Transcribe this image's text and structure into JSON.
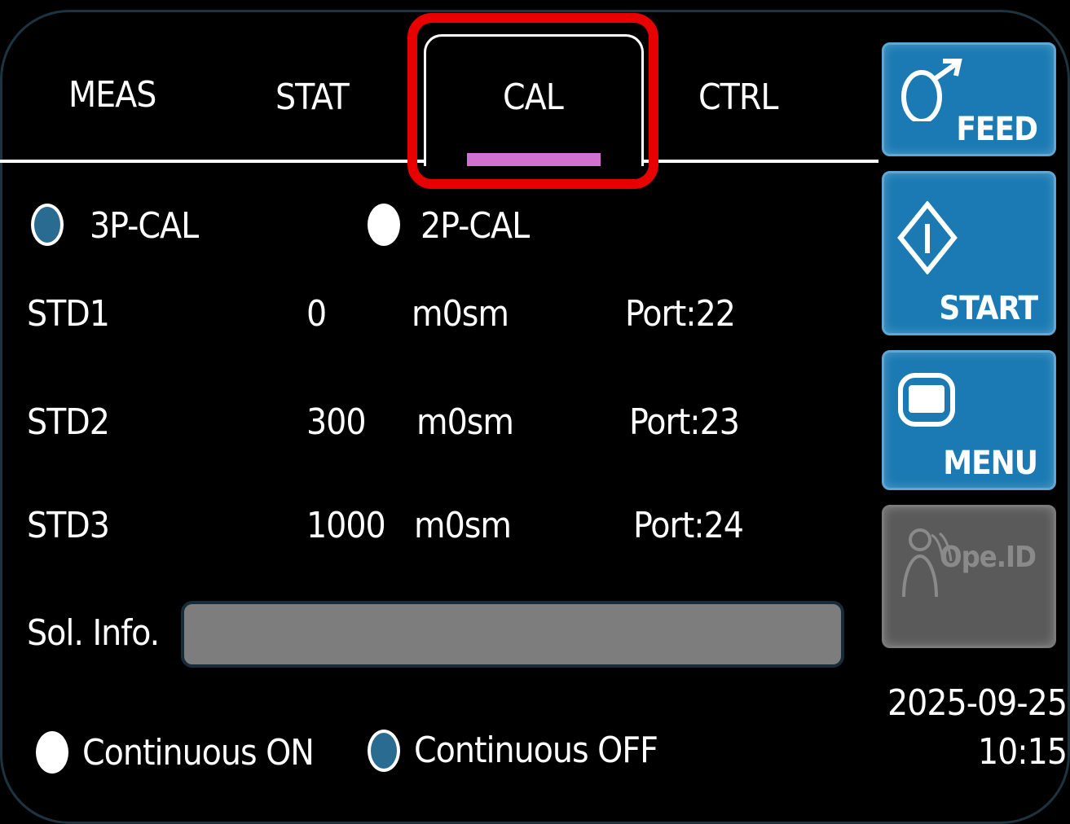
{
  "tabs": {
    "meas": "MEAS",
    "stat": "STAT",
    "cal": "CAL",
    "ctrl": "CTRL",
    "active": "CAL"
  },
  "cal_mode": {
    "options": [
      {
        "label": "3P-CAL",
        "selected": true
      },
      {
        "label": "2P-CAL",
        "selected": false
      }
    ]
  },
  "standards": [
    {
      "name": "STD1",
      "value": "0",
      "unit": "m0sm",
      "port": "Port:22"
    },
    {
      "name": "STD2",
      "value": "300",
      "unit": "m0sm",
      "port": "Port:23"
    },
    {
      "name": "STD3",
      "value": "1000",
      "unit": "m0sm",
      "port": "Port:24"
    }
  ],
  "sol_info": {
    "label": "Sol. Info.",
    "value": ""
  },
  "continuous": {
    "options": [
      {
        "label": "Continuous ON",
        "selected": false
      },
      {
        "label": "Continuous OFF",
        "selected": true
      }
    ]
  },
  "side_buttons": {
    "feed": "FEED",
    "start": "START",
    "menu": "MENU",
    "ope_id": "Ope.ID"
  },
  "status": {
    "date": "2025-09-25",
    "time": "10:15"
  },
  "colors": {
    "background": "#000000",
    "button_blue": "#1b7ab3",
    "radio_selected": "#2a6b92",
    "tab_indicator": "#d070d0",
    "highlight": "#e80000",
    "input_gray": "#7d7d7d"
  },
  "icons": {
    "feed": "feed-arrow-icon",
    "start": "start-diamond-icon",
    "menu": "menu-screen-icon",
    "ope_id": "operator-id-icon"
  }
}
